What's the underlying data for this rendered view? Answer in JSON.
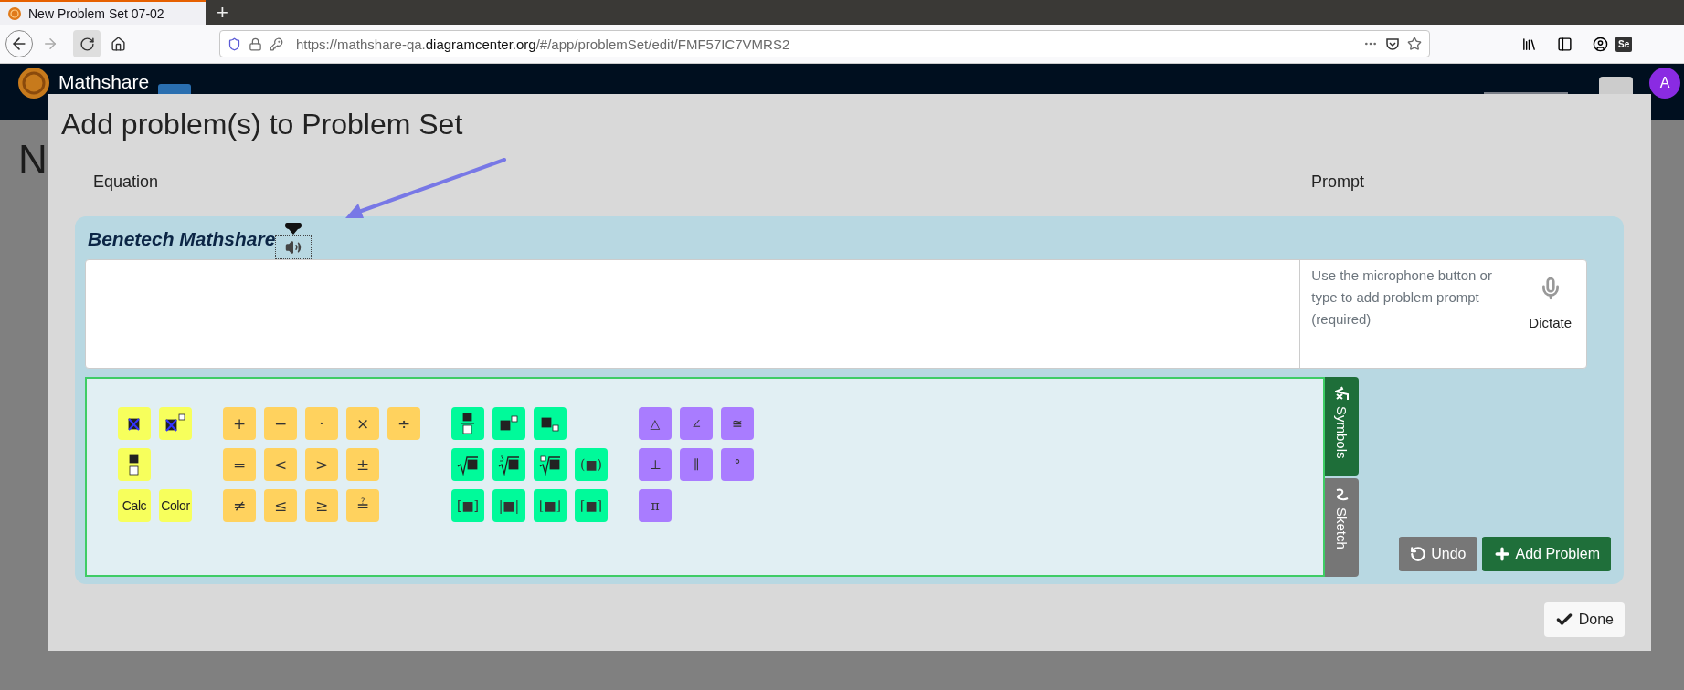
{
  "browser": {
    "tab": {
      "title": "New Problem Set 07-02",
      "selected": true
    },
    "new_tab": "+",
    "url": {
      "prefix": "https://mathshare-qa.",
      "domain": "diagramcenter.org",
      "path": "/#/app/problemSet/edit/FMF57IC7VMRS2"
    },
    "extension": "Se"
  },
  "header": {
    "brand": "Mathshare",
    "avatar": "A"
  },
  "page": {
    "heading": "N"
  },
  "modal": {
    "title": "Add problem(s) to Problem Set",
    "columns": [
      "Equation",
      "Prompt"
    ],
    "editor": {
      "brand": "Benetech Mathshare",
      "prompt": {
        "placeholder": "Use the microphone button or type to add problem prompt (required)"
      },
      "dictate": "Dictate",
      "palette": {
        "groups": [
          {
            "color": "#f7ff5c",
            "rows": [
              [
                {
                  "kind": "cursor"
                },
                {
                  "kind": "cursorpower"
                }
              ],
              [
                {
                  "kind": "stack"
                }
              ],
              [
                {
                  "kind": "symbol",
                  "label": "Calc"
                },
                {
                  "kind": "symbol",
                  "label": "Color"
                }
              ]
            ]
          },
          {
            "color": "#ffd25e",
            "rows": [
              [
                {
                  "kind": "symbol",
                  "label": "+"
                },
                {
                  "kind": "symbol",
                  "label": "−"
                },
                {
                  "kind": "symbol",
                  "label": "·"
                },
                {
                  "kind": "symbol",
                  "label": "×"
                },
                {
                  "kind": "symbol",
                  "label": "÷"
                }
              ],
              [
                {
                  "kind": "symbol",
                  "label": "="
                },
                {
                  "kind": "symbol",
                  "label": "<"
                },
                {
                  "kind": "symbol",
                  "label": ">"
                },
                {
                  "kind": "symbol",
                  "label": "±"
                }
              ],
              [
                {
                  "kind": "symbol",
                  "label": "≠"
                },
                {
                  "kind": "symbol",
                  "label": "≤"
                },
                {
                  "kind": "symbol",
                  "label": "≥"
                },
                {
                  "kind": "symbol",
                  "label": "≟"
                }
              ]
            ]
          },
          {
            "color": "#00fa9a",
            "rows": [
              [
                {
                  "kind": "fraction"
                },
                {
                  "kind": "power"
                },
                {
                  "kind": "subscript"
                }
              ],
              [
                {
                  "kind": "sqrt"
                },
                {
                  "kind": "cuberoot"
                },
                {
                  "kind": "nthroot"
                },
                {
                  "kind": "symbol",
                  "label": "(■)"
                }
              ],
              [
                {
                  "kind": "symbol",
                  "label": "[■]"
                },
                {
                  "kind": "symbol",
                  "label": "|■|"
                },
                {
                  "kind": "symbol",
                  "label": "⌊■⌋"
                },
                {
                  "kind": "symbol",
                  "label": "⌈■⌉"
                }
              ]
            ]
          },
          {
            "color": "#a97cff",
            "rows": [
              [
                {
                  "kind": "symbol",
                  "label": "△"
                },
                {
                  "kind": "symbol",
                  "label": "∠"
                },
                {
                  "kind": "symbol",
                  "label": "≅"
                }
              ],
              [
                {
                  "kind": "symbol",
                  "label": "⊥"
                },
                {
                  "kind": "symbol",
                  "label": "∥"
                },
                {
                  "kind": "symbol",
                  "label": "°"
                }
              ],
              [
                {
                  "kind": "symbol",
                  "label": "π"
                }
              ]
            ]
          }
        ]
      },
      "tabs": [
        {
          "label": "Symbols",
          "kind": "symbols",
          "selected": true
        },
        {
          "label": "Sketch",
          "kind": "sketch",
          "selected": false
        }
      ],
      "actions": [
        {
          "label": "Undo",
          "kind": "undo"
        },
        {
          "label": "Add Problem",
          "kind": "add"
        }
      ]
    },
    "done": "Done"
  }
}
